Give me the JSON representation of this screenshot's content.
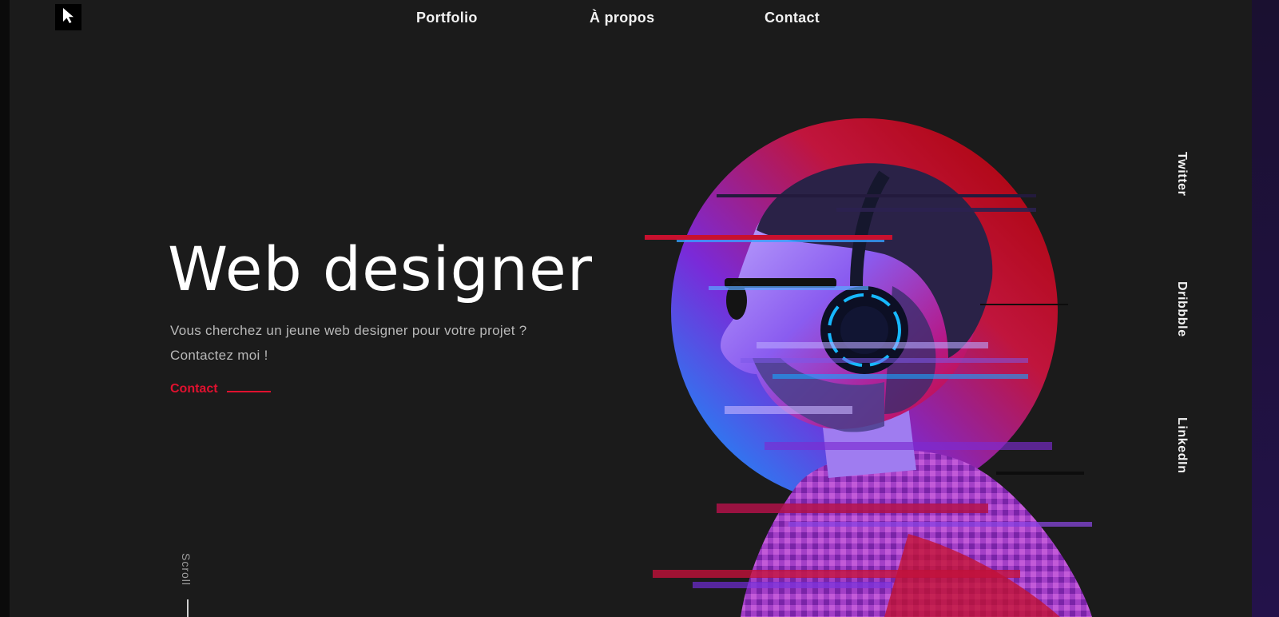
{
  "nav": {
    "items": [
      {
        "label": "Portfolio"
      },
      {
        "label": "À propos"
      },
      {
        "label": "Contact"
      }
    ]
  },
  "hero": {
    "title": "Web designer",
    "subtitle_lines": [
      "Vous cherchez un jeune web designer pour votre projet ?",
      "Contactez moi !"
    ],
    "cta_label": "Contact"
  },
  "scroll_label": "Scroll",
  "social": {
    "items": [
      {
        "label": "Twitter"
      },
      {
        "label": "Dribbble"
      },
      {
        "label": "LinkedIn"
      }
    ]
  },
  "icons": {
    "logo": "cursor-arrow-icon"
  },
  "colors": {
    "background": "#1b1b1b",
    "accent": "#e0112f",
    "text": "#f2f2f2",
    "muted": "#b9b9b9"
  }
}
